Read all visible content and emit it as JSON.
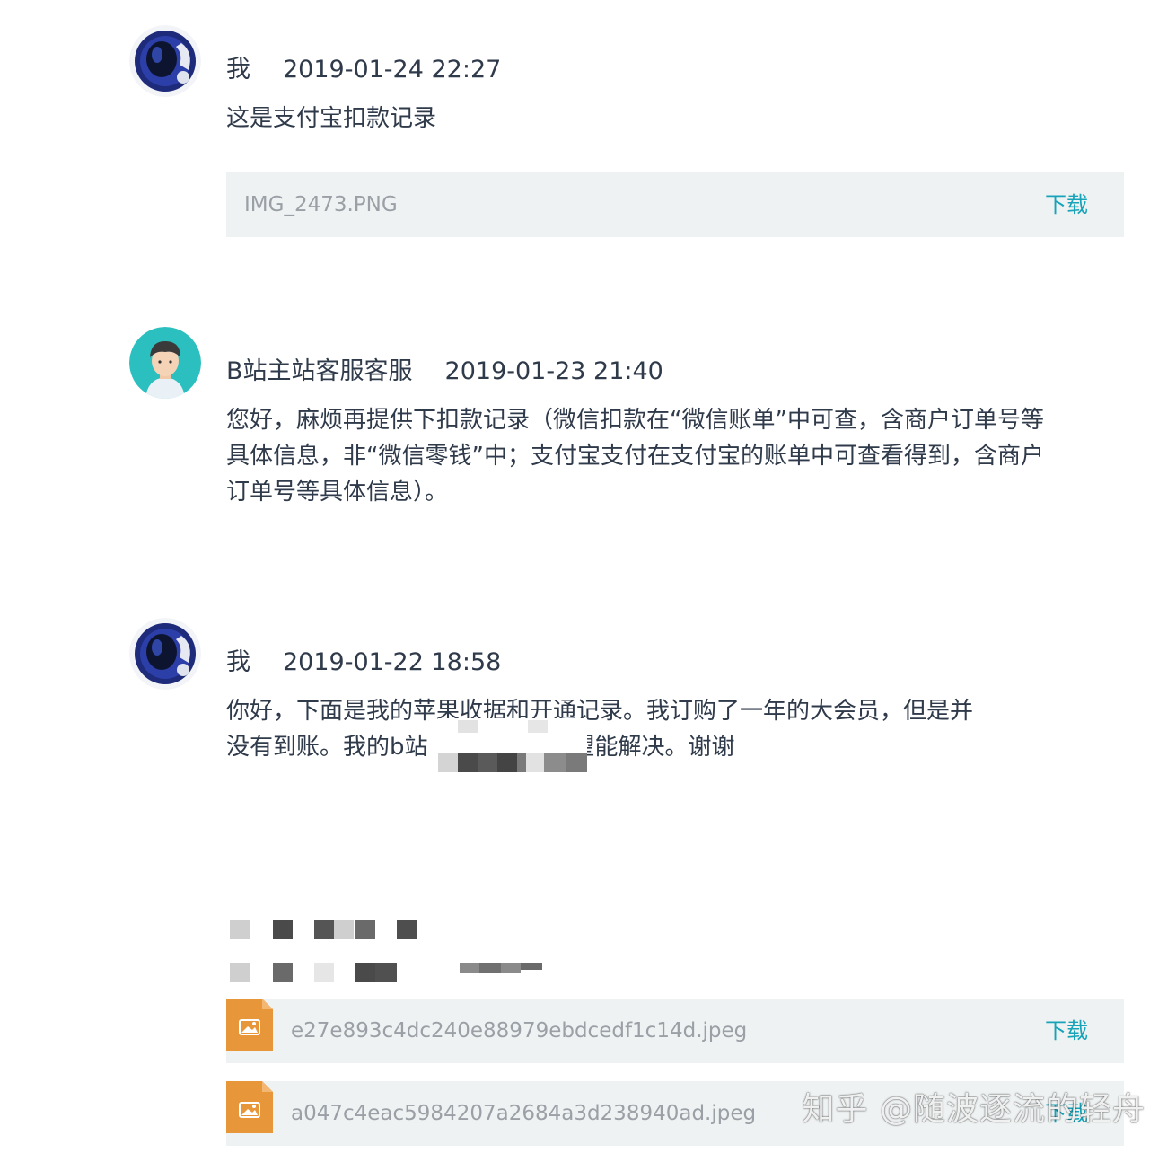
{
  "messages": [
    {
      "author": "我",
      "time": "2019-01-24 22:27",
      "text": "这是支付宝扣款记录",
      "attachment": {
        "filename": "IMG_2473.PNG",
        "download_label": "下载"
      }
    },
    {
      "author": "B站主站客服客服",
      "time": "2019-01-23 21:40",
      "text": "您好，麻烦再提供下扣款记录（微信扣款在“微信账单”中可查，含商户订单号等具体信息，非“微信零钱”中；支付宝支付在支付宝的账单中可查看得到，含商户订单号等具体信息）。"
    },
    {
      "author": "我",
      "time": "2019-01-22 18:58",
      "text_line1": "你好，下面是我的苹果收据和开通记录。我订购了一年的大会员，但是并",
      "text_line2_start": "没有到账。我的b站",
      "text_line2_end": "望能解决。谢谢",
      "attachments": [
        {
          "filename": "e27e893c4dc240e88979ebdcedf1c14d.jpeg",
          "download_label": "下载"
        },
        {
          "filename": "a047c4eac5984207a2684a3d238940ad.jpeg",
          "download_label": "下载"
        }
      ]
    }
  ],
  "watermark": "知乎 @随波逐流的轻舟",
  "colors": {
    "accent": "#17a3b8",
    "file_bg": "#eef2f2",
    "file_icon": "#e8963a"
  },
  "icons": {
    "user_avatar": "astronaut-avatar",
    "support_avatar": "support-agent-avatar",
    "file": "image-file-icon"
  }
}
